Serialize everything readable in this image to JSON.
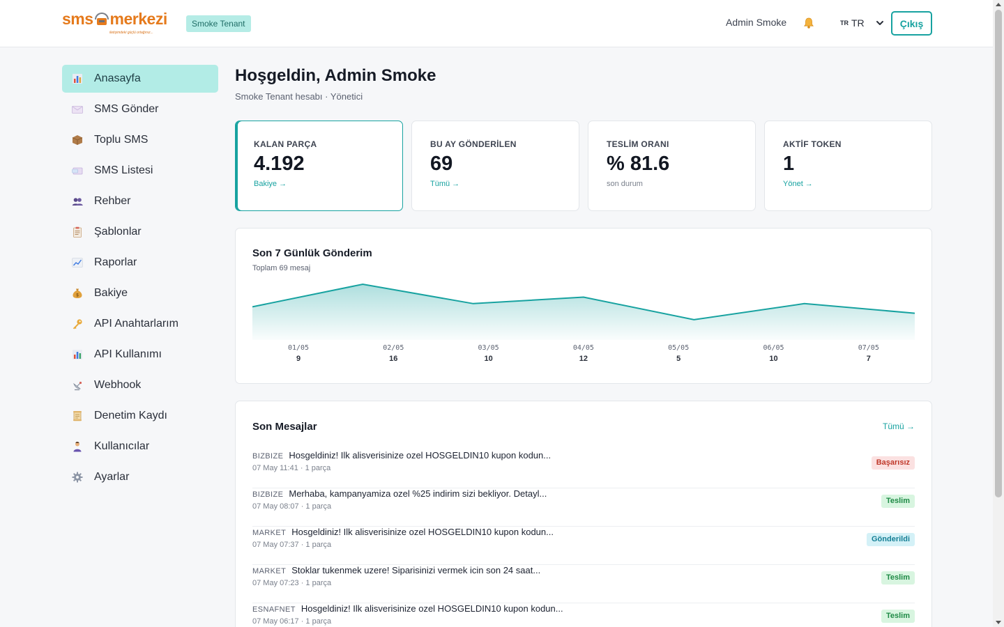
{
  "header": {
    "logo_text_left": "sms",
    "logo_text_right": "merkezi",
    "logo_tagline": "iletişimdeki güçlü ortağınız...",
    "tenant_badge": "Smoke Tenant",
    "user_name": "Admin Smoke",
    "lang_code": "TR",
    "lang_label": "TR",
    "logout_label": "Çıkış",
    "bell_icon": "bell-icon",
    "accent_color": "#17a2a0"
  },
  "sidebar": {
    "items": [
      {
        "label": "Anasayfa",
        "icon": "bar-chart-icon",
        "active": true
      },
      {
        "label": "SMS Gönder",
        "icon": "envelope-icon"
      },
      {
        "label": "Toplu SMS",
        "icon": "package-icon"
      },
      {
        "label": "SMS Listesi",
        "icon": "envelopes-icon"
      },
      {
        "label": "Rehber",
        "icon": "contacts-icon"
      },
      {
        "label": "Şablonlar",
        "icon": "clipboard-icon"
      },
      {
        "label": "Raporlar",
        "icon": "line-chart-icon"
      },
      {
        "label": "Bakiye",
        "icon": "money-bag-icon"
      },
      {
        "label": "API Anahtarlarım",
        "icon": "key-icon"
      },
      {
        "label": "API Kullanımı",
        "icon": "bar-chart-icon"
      },
      {
        "label": "Webhook",
        "icon": "satellite-icon"
      },
      {
        "label": "Denetim Kaydı",
        "icon": "scroll-icon"
      },
      {
        "label": "Kullanıcılar",
        "icon": "user-icon"
      },
      {
        "label": "Ayarlar",
        "icon": "gear-icon"
      }
    ]
  },
  "main": {
    "title": "Hoşgeldin, Admin Smoke",
    "subtitle": "Smoke Tenant hesabı · Yönetici",
    "stats": [
      {
        "label": "KALAN PARÇA",
        "value": "4.192",
        "link": "Bakiye →",
        "active": true
      },
      {
        "label": "BU AY GÖNDERİLEN",
        "value": "69",
        "link": "Tümü →"
      },
      {
        "label": "TESLİM ORANI",
        "value": "% 81.6",
        "note": "son durum"
      },
      {
        "label": "AKTİF TOKEN",
        "value": "1",
        "link": "Yönet →"
      }
    ],
    "chart": {
      "title": "Son 7 Günlük Gönderim",
      "subtitle": "Toplam 69 mesaj"
    },
    "messages": {
      "title": "Son Mesajlar",
      "all_link": "Tümü →",
      "rows": [
        {
          "sender": "BIZBIZE",
          "text": "Hosgeldiniz! Ilk alisverisinize ozel HOSGELDIN10 kupon kodun...",
          "meta": "07 May 11:41 · 1 parça",
          "status": "Başarısız",
          "status_type": "fail"
        },
        {
          "sender": "BIZBIZE",
          "text": "Merhaba, kampanyamiza ozel %25 indirim sizi bekliyor. Detayl...",
          "meta": "07 May 08:07 · 1 parça",
          "status": "Teslim",
          "status_type": "ok"
        },
        {
          "sender": "MARKET",
          "text": "Hosgeldiniz! Ilk alisverisinize ozel HOSGELDIN10 kupon kodun...",
          "meta": "07 May 07:37 · 1 parça",
          "status": "Gönderildi",
          "status_type": "sent"
        },
        {
          "sender": "MARKET",
          "text": "Stoklar tukenmek uzere! Siparisinizi vermek icin son 24 saat...",
          "meta": "07 May 07:23 · 1 parça",
          "status": "Teslim",
          "status_type": "ok"
        },
        {
          "sender": "ESNAFNET",
          "text": "Hosgeldiniz! Ilk alisverisinize ozel HOSGELDIN10 kupon kodun...",
          "meta": "07 May 06:17 · 1 parça",
          "status": "Teslim",
          "status_type": "ok"
        }
      ]
    }
  },
  "chart_data": {
    "type": "area",
    "categories": [
      "01/05",
      "02/05",
      "03/05",
      "04/05",
      "05/05",
      "06/05",
      "07/05"
    ],
    "values": [
      9,
      16,
      10,
      12,
      5,
      10,
      7
    ],
    "title": "Son 7 Günlük Gönderim",
    "subtitle": "Toplam 69 mesaj",
    "xlabel": "",
    "ylabel": "",
    "ylim": [
      0,
      16
    ],
    "grid": false,
    "legend": "none",
    "line_color": "#17a2a0"
  }
}
